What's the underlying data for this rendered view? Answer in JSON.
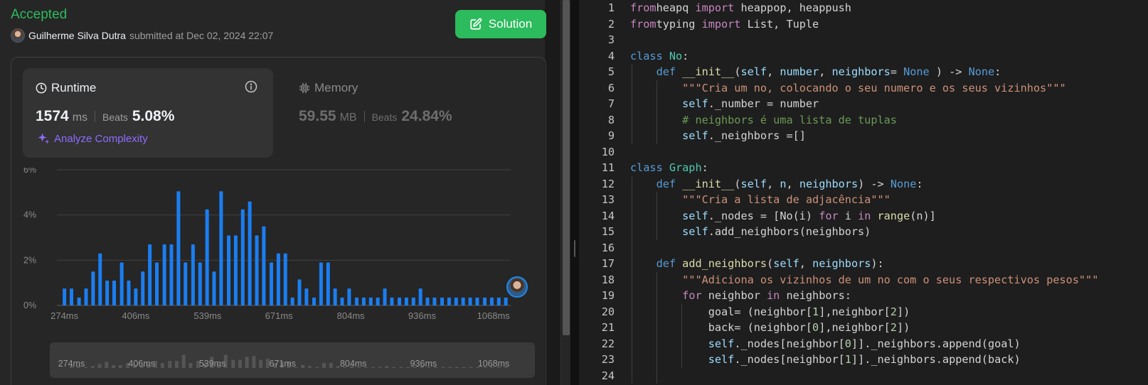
{
  "result": {
    "status": "Accepted",
    "submitter": "Guilherme Silva Dutra",
    "submitted_text": "submitted at Dec 02, 2024 22:07",
    "solution_label": "Solution"
  },
  "runtime": {
    "label": "Runtime",
    "value": "1574",
    "unit": "ms",
    "beats_label": "Beats",
    "beats": "5.08%",
    "analyze_label": "Analyze Complexity"
  },
  "memory": {
    "label": "Memory",
    "value": "59.55",
    "unit": "MB",
    "beats_label": "Beats",
    "beats": "24.84%"
  },
  "colors": {
    "accepted": "#2cbb5d",
    "bar": "#1a7ef2",
    "analyze": "#8f6cff"
  },
  "chart_data": {
    "type": "bar",
    "y_ticks": [
      "6%",
      "4%",
      "2%",
      "0%"
    ],
    "ylim": [
      0,
      6
    ],
    "x_ticks": [
      "274ms",
      "406ms",
      "539ms",
      "671ms",
      "804ms",
      "936ms",
      "1068ms"
    ],
    "x_tick_positions": [
      274,
      406,
      539,
      671,
      804,
      936,
      1068
    ],
    "xlim": [
      260,
      1100
    ],
    "grid": true,
    "bar_x": [
      274,
      287,
      301,
      314,
      327,
      340,
      353,
      366,
      380,
      393,
      406,
      419,
      432,
      445,
      459,
      472,
      485,
      498,
      512,
      525,
      538,
      551,
      564,
      578,
      591,
      604,
      617,
      630,
      643,
      657,
      670,
      683,
      696,
      709,
      722,
      736,
      749,
      762,
      775,
      788,
      801,
      815,
      828,
      841,
      854,
      867,
      880,
      894,
      907,
      920,
      933,
      946,
      959,
      973,
      986,
      999,
      1012,
      1025,
      1038,
      1052,
      1065,
      1078,
      1091
    ],
    "values": [
      0.75,
      0.75,
      0.35,
      0.75,
      1.5,
      2.3,
      1.1,
      1.1,
      1.9,
      1.1,
      0.75,
      1.5,
      2.7,
      1.9,
      2.7,
      2.7,
      5.05,
      1.9,
      2.7,
      1.9,
      4.25,
      1.5,
      5.05,
      3.1,
      3.1,
      4.25,
      4.6,
      3.1,
      3.5,
      1.9,
      2.3,
      2.3,
      0.35,
      1.15,
      0.75,
      0.35,
      1.9,
      1.9,
      0.75,
      0.35,
      0.75,
      0.35,
      0.35,
      0.35,
      0.35,
      0.75,
      0.35,
      0.35,
      0.35,
      0.35,
      0.75,
      0.35,
      0.35,
      0.35,
      0.35,
      0.35,
      0.35,
      0.35,
      0.35,
      0.35,
      0.35,
      0.35,
      0.35
    ],
    "marker_x": 1092
  },
  "editor": {
    "lines": [
      [
        [
          "k",
          "from"
        ],
        [
          "",
          "heapq "
        ],
        [
          "k",
          "import"
        ],
        [
          "",
          " heappop, heappush"
        ]
      ],
      [
        [
          "k",
          "from"
        ],
        [
          "",
          "typing "
        ],
        [
          "k",
          "import"
        ],
        [
          "",
          " List, Tuple"
        ]
      ],
      [],
      [
        [
          "d",
          "class"
        ],
        [
          "",
          " "
        ],
        [
          "c",
          "No"
        ],
        [
          "",
          ":"
        ]
      ],
      [
        [
          "",
          "    "
        ],
        [
          "d",
          "def"
        ],
        [
          "",
          " "
        ],
        [
          "f",
          "__init__"
        ],
        [
          "",
          "("
        ],
        [
          "p",
          "self"
        ],
        [
          "",
          ", "
        ],
        [
          "p",
          "number"
        ],
        [
          "",
          ", "
        ],
        [
          "p",
          "neighbors"
        ],
        [
          "",
          "= "
        ],
        [
          "d",
          "None"
        ],
        [
          "",
          " ) -> "
        ],
        [
          "d",
          "None"
        ],
        [
          "",
          ":"
        ]
      ],
      [
        [
          "",
          "        "
        ],
        [
          "s",
          "\"\"\"Cria um no, colocando o seu numero e os seus vizinhos\"\"\""
        ]
      ],
      [
        [
          "",
          "        "
        ],
        [
          "p",
          "self"
        ],
        [
          "",
          "._number = number"
        ]
      ],
      [
        [
          "",
          "        "
        ],
        [
          "m",
          "# neighbors é uma lista de tuplas"
        ]
      ],
      [
        [
          "",
          "        "
        ],
        [
          "p",
          "self"
        ],
        [
          "",
          "._neighbors =[]"
        ]
      ],
      [],
      [
        [
          "d",
          "class"
        ],
        [
          "",
          " "
        ],
        [
          "c",
          "Graph"
        ],
        [
          "",
          ":"
        ]
      ],
      [
        [
          "",
          "    "
        ],
        [
          "d",
          "def"
        ],
        [
          "",
          " "
        ],
        [
          "f",
          "__init__"
        ],
        [
          "",
          "("
        ],
        [
          "p",
          "self"
        ],
        [
          "",
          ", "
        ],
        [
          "p",
          "n"
        ],
        [
          "",
          ", "
        ],
        [
          "p",
          "neighbors"
        ],
        [
          "",
          ") -> "
        ],
        [
          "d",
          "None"
        ],
        [
          "",
          ":"
        ]
      ],
      [
        [
          "",
          "        "
        ],
        [
          "s",
          "\"\"\"Cria a lista de adjacência\"\"\""
        ]
      ],
      [
        [
          "",
          "        "
        ],
        [
          "p",
          "self"
        ],
        [
          "",
          "._nodes = [No(i) "
        ],
        [
          "k",
          "for"
        ],
        [
          "",
          " i "
        ],
        [
          "k",
          "in"
        ],
        [
          "",
          " "
        ],
        [
          "f",
          "range"
        ],
        [
          "",
          "(n)]"
        ]
      ],
      [
        [
          "",
          "        "
        ],
        [
          "p",
          "self"
        ],
        [
          "",
          ".add_neighbors(neighbors)"
        ]
      ],
      [],
      [
        [
          "",
          "    "
        ],
        [
          "d",
          "def"
        ],
        [
          "",
          " "
        ],
        [
          "f",
          "add_neighbors"
        ],
        [
          "",
          "("
        ],
        [
          "p",
          "self"
        ],
        [
          "",
          ", "
        ],
        [
          "p",
          "neighbors"
        ],
        [
          "",
          "):"
        ]
      ],
      [
        [
          "",
          "        "
        ],
        [
          "s",
          "\"\"\"Adiciona os vizinhos de um no com o seus respectivos pesos\"\"\""
        ]
      ],
      [
        [
          "",
          "        "
        ],
        [
          "k",
          "for"
        ],
        [
          "",
          " neighbor "
        ],
        [
          "k",
          "in"
        ],
        [
          "",
          " neighbors:"
        ]
      ],
      [
        [
          "",
          "            goal= (neighbor["
        ],
        [
          "n",
          "1"
        ],
        [
          "",
          "],neighbor["
        ],
        [
          "n",
          "2"
        ],
        [
          "",
          "])"
        ]
      ],
      [
        [
          "",
          "            back= (neighbor["
        ],
        [
          "n",
          "0"
        ],
        [
          "",
          "],neighbor["
        ],
        [
          "n",
          "2"
        ],
        [
          "",
          "])"
        ]
      ],
      [
        [
          "",
          "            "
        ],
        [
          "p",
          "self"
        ],
        [
          "",
          "._nodes[neighbor["
        ],
        [
          "n",
          "0"
        ],
        [
          "",
          "]]._neighbors.append(goal)"
        ]
      ],
      [
        [
          "",
          "            "
        ],
        [
          "p",
          "self"
        ],
        [
          "",
          "._nodes[neighbor["
        ],
        [
          "n",
          "1"
        ],
        [
          "",
          "]]._neighbors.append(back)"
        ]
      ],
      []
    ]
  }
}
